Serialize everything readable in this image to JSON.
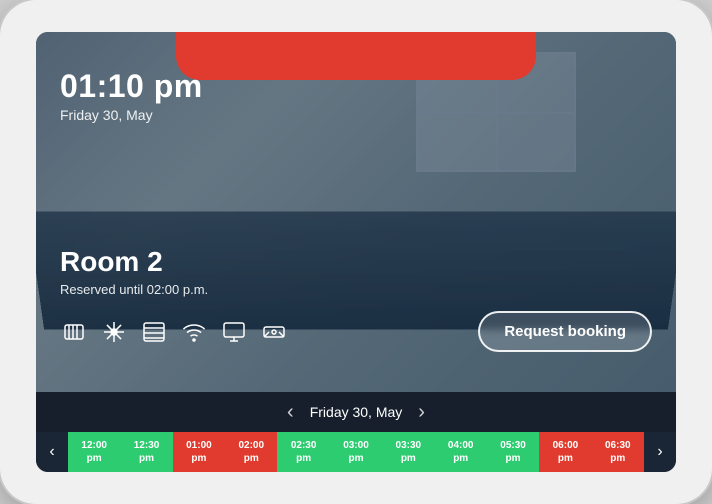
{
  "device": {
    "type": "tablet"
  },
  "topBar": {
    "color": "#e03b2e"
  },
  "header": {
    "time": "01:10 pm",
    "date": "Friday 30, May"
  },
  "room": {
    "name": "Room 2",
    "status": "Reserved until 02:00 p.m."
  },
  "amenities": [
    {
      "icon": "⊞",
      "name": "heating-icon"
    },
    {
      "icon": "❄",
      "name": "ac-icon"
    },
    {
      "icon": "≡",
      "name": "ventilation-icon"
    },
    {
      "icon": "wifi",
      "name": "wifi-icon"
    },
    {
      "icon": "⊟",
      "name": "screen-icon"
    },
    {
      "icon": "⊡",
      "name": "projector-icon"
    }
  ],
  "requestButton": {
    "label": "Request booking"
  },
  "navigation": {
    "prevArrow": "‹",
    "nextArrow": "›",
    "date": "Friday 30, May"
  },
  "timeline": {
    "prevArrow": "‹",
    "nextArrow": "›",
    "slots": [
      {
        "time": "12:00",
        "period": "pm",
        "type": "available"
      },
      {
        "time": "12:30",
        "period": "pm",
        "type": "available"
      },
      {
        "time": "01:00",
        "period": "pm",
        "type": "reserved"
      },
      {
        "time": "02:00",
        "period": "pm",
        "type": "reserved"
      },
      {
        "time": "02:30",
        "period": "pm",
        "type": "available"
      },
      {
        "time": "03:00",
        "period": "pm",
        "type": "available"
      },
      {
        "time": "03:30",
        "period": "pm",
        "type": "available"
      },
      {
        "time": "04:00",
        "period": "pm",
        "type": "available"
      },
      {
        "time": "05:30",
        "period": "pm",
        "type": "available"
      },
      {
        "time": "06:00",
        "period": "pm",
        "type": "reserved"
      },
      {
        "time": "06:30",
        "period": "pm",
        "type": "reserved"
      }
    ]
  },
  "colors": {
    "available": "#2ecc71",
    "reserved": "#e03b2e",
    "accent": "#e03b2e",
    "navBg": "rgba(20,30,45,0.85)"
  }
}
